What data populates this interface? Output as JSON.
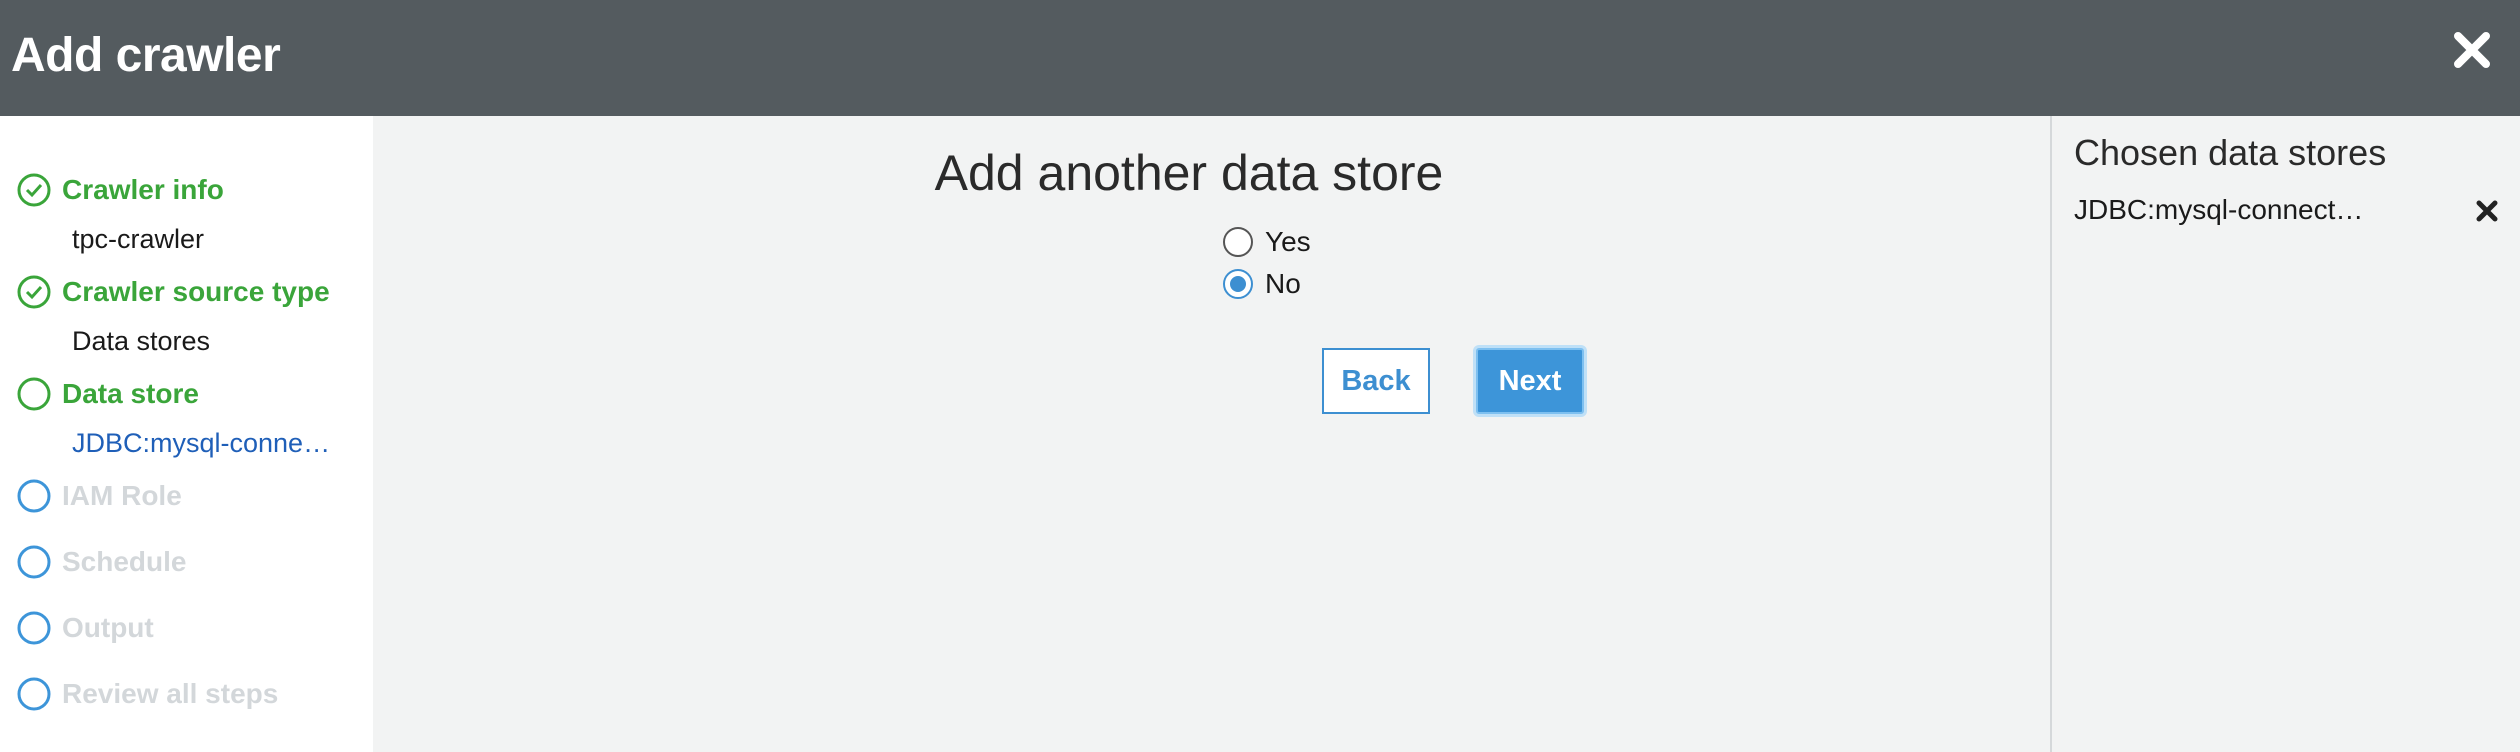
{
  "header": {
    "title": "Add crawler"
  },
  "sidebar": {
    "steps": [
      {
        "label": "Crawler info",
        "sub": "tpc-crawler"
      },
      {
        "label": "Crawler source type",
        "sub": "Data stores"
      },
      {
        "label": "Data store",
        "sub": "JDBC:mysql-conne…"
      },
      {
        "label": "IAM Role"
      },
      {
        "label": "Schedule"
      },
      {
        "label": "Output"
      },
      {
        "label": "Review all steps"
      }
    ]
  },
  "main": {
    "heading": "Add another data store",
    "options": [
      {
        "label": "Yes",
        "selected": false
      },
      {
        "label": "No",
        "selected": true
      }
    ],
    "back_label": "Back",
    "next_label": "Next"
  },
  "right_panel": {
    "title": "Chosen data stores",
    "items": [
      {
        "label": "JDBC:mysql-connect…"
      }
    ]
  },
  "colors": {
    "header_bg": "#545b5f",
    "done_green": "#3aa53a",
    "accent_blue": "#3d95d9",
    "link_blue": "#1f5fb8"
  }
}
